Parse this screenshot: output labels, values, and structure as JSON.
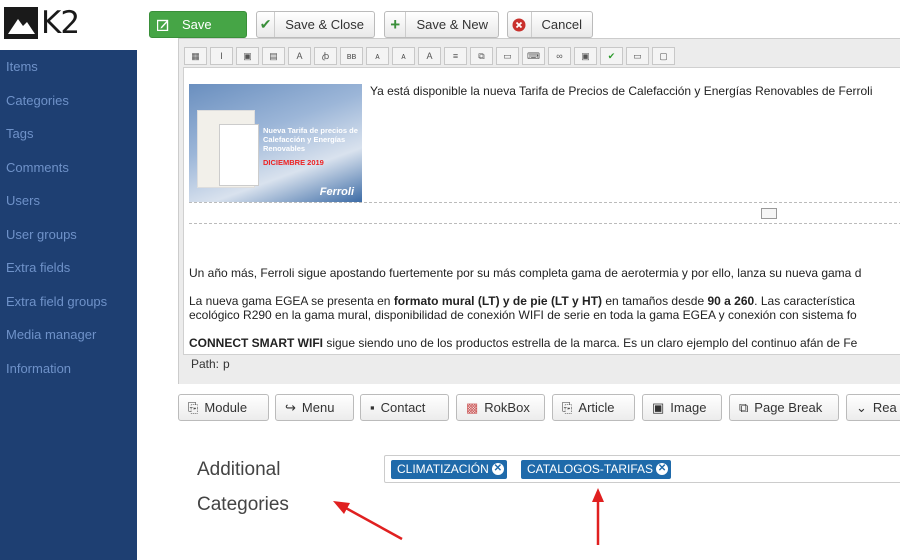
{
  "app": {
    "logo_text": "K2"
  },
  "toolbar": {
    "save_label": "Save",
    "save_close_label": "Save & Close",
    "save_new_label": "Save & New",
    "cancel_label": "Cancel"
  },
  "sidebar": {
    "items": [
      {
        "label": "Items"
      },
      {
        "label": "Categories"
      },
      {
        "label": "Tags"
      },
      {
        "label": "Comments"
      },
      {
        "label": "Users"
      },
      {
        "label": "User groups"
      },
      {
        "label": "Extra fields"
      },
      {
        "label": "Extra field groups"
      },
      {
        "label": "Media manager"
      },
      {
        "label": "Information"
      }
    ]
  },
  "editor": {
    "image_headline": "Nueva Tarifa de precios de Calefacción y Energías Renovables",
    "image_date": "DICIEMBRE 2019",
    "image_brand": "Ferroli",
    "caption": "Ya está disponible la nueva Tarifa de Precios de Calefacción y Energías Renovables de Ferroli",
    "para1": "Un año más, Ferroli sigue apostando fuertemente por su más completa gama de aerotermia y por ello, lanza su nueva gama d",
    "para2_a": "La nueva gama EGEA se presenta en ",
    "para2_b": "formato mural (LT) y de pie (LT y HT)",
    "para2_c": " en tamaños desde ",
    "para2_d": "90 a 260",
    "para2_e": ". Las característica",
    "para3": "ecológico R290 en la gama mural, disponibilidad de conexión WIFI de serie en toda la gama EGEA y conexión con sistema fo",
    "para4_a": "CONNECT SMART WIFI",
    "para4_b": " sigue siendo uno de los productos estrella de la marca. Es un claro ejemplo del continuo afán de Fe",
    "path_label": "Path:",
    "path_value": "p"
  },
  "editor_buttons": [
    {
      "label": "Module"
    },
    {
      "label": "Menu"
    },
    {
      "label": "Contact"
    },
    {
      "label": "RokBox"
    },
    {
      "label": "Article"
    },
    {
      "label": "Image"
    },
    {
      "label": "Page Break"
    },
    {
      "label": "Rea"
    }
  ],
  "additional_categories": {
    "label": "Additional Categories",
    "tags": [
      {
        "label": "CLIMATIZACIÓN"
      },
      {
        "label": "CATALOGOS-TARIFAS"
      }
    ]
  },
  "colors": {
    "sidebar_bg": "#1e3f72",
    "sidebar_text": "#6f92c9",
    "save_green": "#46a546",
    "tag_blue": "#1f6aaa",
    "arrow_red": "#e02020"
  }
}
